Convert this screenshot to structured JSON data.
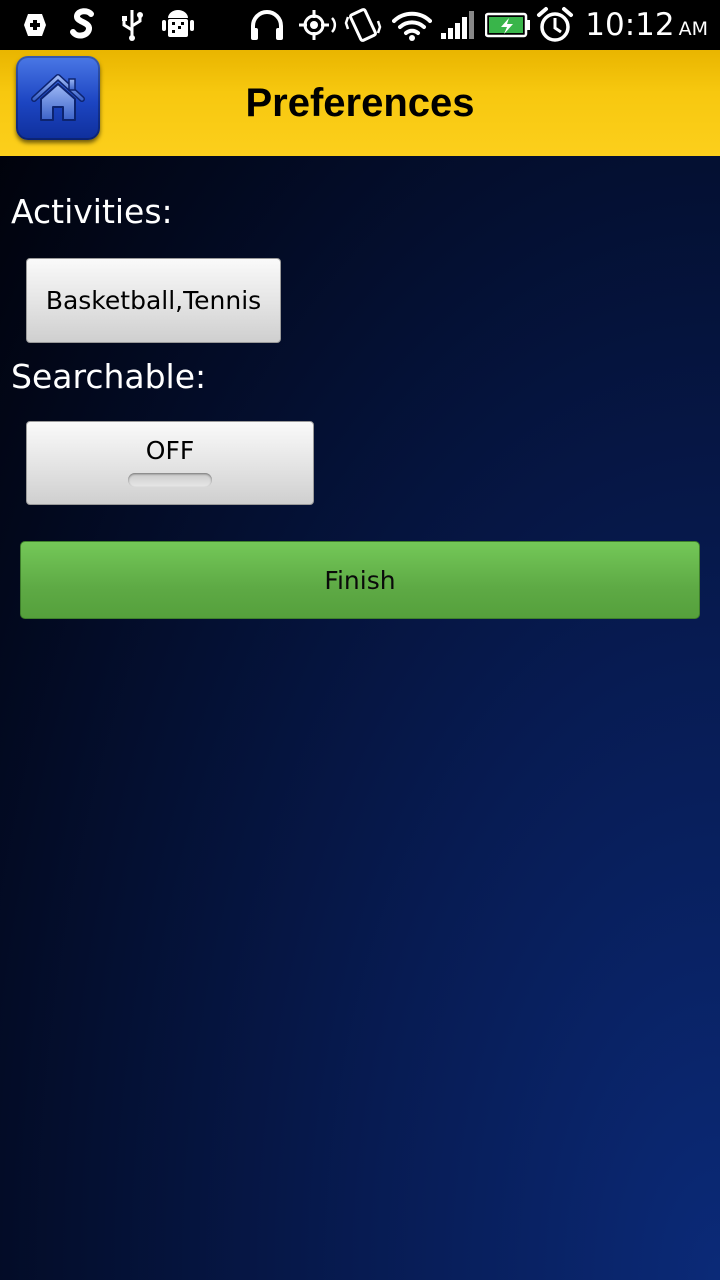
{
  "status_bar": {
    "time": "10:12",
    "ampm": "AM",
    "icons": [
      "medical-icon",
      "swype-icon",
      "usb-icon",
      "android-debug-icon",
      "headphones-icon",
      "gps-icon",
      "vibrate-icon",
      "wifi-icon",
      "signal-icon",
      "battery-charging-icon",
      "alarm-icon"
    ]
  },
  "title_bar": {
    "title": "Preferences",
    "home_icon": "home-icon"
  },
  "form": {
    "activities_label": "Activities:",
    "activities_value": "Basketball,Tennis",
    "searchable_label": "Searchable:",
    "searchable_value": "OFF",
    "finish_label": "Finish"
  },
  "colors": {
    "title_bar": "#f7c80f",
    "finish_button": "#5eaa45",
    "background": "#071b52"
  }
}
